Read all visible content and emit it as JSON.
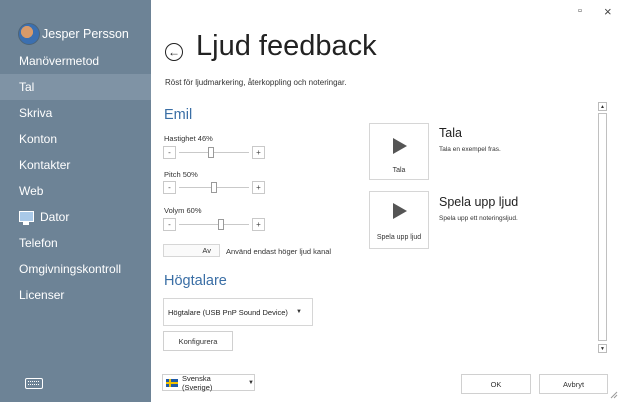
{
  "user": {
    "name": "Jesper Persson"
  },
  "sidebar": {
    "items": [
      {
        "label": "Manövermetod",
        "active": false
      },
      {
        "label": "Tal",
        "active": true
      },
      {
        "label": "Skriva",
        "active": false
      },
      {
        "label": "Konton",
        "active": false
      },
      {
        "label": "Kontakter",
        "active": false
      },
      {
        "label": "Web",
        "active": false
      },
      {
        "label": "Dator",
        "active": false,
        "icon": "monitor-icon"
      },
      {
        "label": "Telefon",
        "active": false
      },
      {
        "label": "Omgivningskontroll",
        "active": false
      },
      {
        "label": "Licenser",
        "active": false
      }
    ]
  },
  "window": {
    "minimize": "▫",
    "close": "×"
  },
  "page": {
    "title": "Ljud feedback",
    "subtitle": "Röst för ljudmarkering, återkoppling och noteringar."
  },
  "voice": {
    "section_title": "Emil",
    "speed_label": "Hastighet 46%",
    "speed_value": 46,
    "pitch_label": "Pitch 50%",
    "pitch_value": 50,
    "volume_label": "Volym 60%",
    "volume_value": 60,
    "minus": "-",
    "plus": "+",
    "toggle_state": "Av",
    "toggle_label": "Använd endast höger ljud kanal"
  },
  "speaker": {
    "section_title": "Högtalare",
    "device": "Högtalare (USB PnP Sound Device)",
    "configure": "Konfigurera"
  },
  "actions": {
    "speak": {
      "button": "Tala",
      "title": "Tala",
      "desc": "Tala en exempel fras."
    },
    "play": {
      "button": "Spela upp ljud",
      "title": "Spela upp ljud",
      "desc": "Spela upp ett noteringsljud."
    }
  },
  "footer": {
    "language": "Svenska (Sverige)",
    "ok": "OK",
    "cancel": "Avbryt"
  },
  "colors": {
    "sidebar": "#6d8396",
    "sidebar_active": "#7f93a5",
    "accent": "#3a6ea5"
  }
}
